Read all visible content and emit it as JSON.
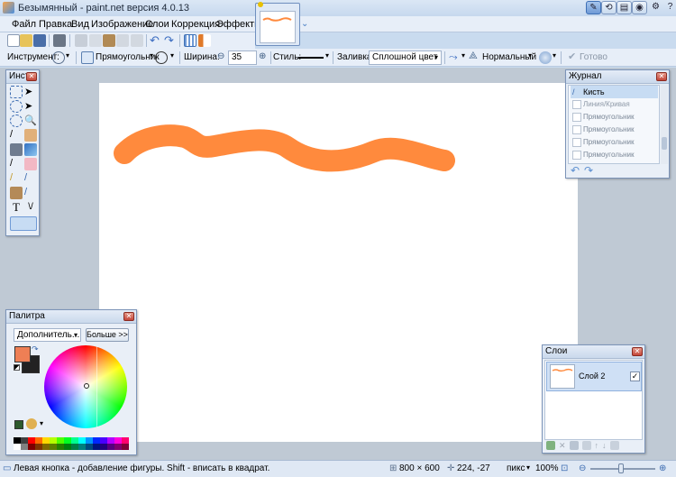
{
  "window": {
    "title": "Безымянный - paint.net версия 4.0.13"
  },
  "menu": {
    "items": [
      "Файл",
      "Правка",
      "Вид",
      "Изображение",
      "Слои",
      "Коррекция",
      "Эффекты"
    ]
  },
  "toolbar": {
    "tool_label": "Инструмент:",
    "shape_name": "Прямоугольник",
    "width_label": "Ширина:",
    "width_value": "35",
    "style_label": "Стиль:",
    "fill_label": "Заливка:",
    "fill_value": "Сплошной цвет",
    "blend_mode": "Нормальный",
    "done_label": "Готово"
  },
  "tools": {
    "title": "Инст..."
  },
  "history": {
    "title": "Журнал",
    "items": [
      "Кисть",
      "Линия/Кривая Прямоугольник",
      "Прямоугольник Прямоугольник",
      "Прямоугольник Прямоугольник",
      "Прямоугольник Прямоугольник",
      "Прямоугольник Прямоугольник",
      "Прямоугольник Прямоугольник"
    ]
  },
  "palette": {
    "title": "Палитра",
    "mode": "Дополнитель...",
    "more_button": "Больше >>",
    "primary_color": "#ee7f55",
    "secondary_color": "#222222",
    "swatches": [
      "#000000",
      "#404040",
      "#ff0000",
      "#ff6a00",
      "#ffd800",
      "#b6ff00",
      "#4cff00",
      "#00ff21",
      "#00ff90",
      "#00ffff",
      "#0094ff",
      "#0026ff",
      "#4800ff",
      "#b200ff",
      "#ff00dc",
      "#ff006e",
      "#ffffff",
      "#808080",
      "#7f0000",
      "#7f3300",
      "#7f6a00",
      "#5b7f00",
      "#267f00",
      "#007f0e",
      "#007f46",
      "#007f7f",
      "#004a7f",
      "#00137f",
      "#21007f",
      "#57007f",
      "#7f006e",
      "#7f0037"
    ]
  },
  "layers": {
    "title": "Слои",
    "items": [
      {
        "name": "Слой 2",
        "visible": true
      }
    ]
  },
  "canvas": {
    "stroke_color": "#ff8a3d"
  },
  "status": {
    "hint": "Левая кнопка - добавление фигуры. Shift - вписать в квадрат.",
    "size": "800 × 600",
    "cursor": "224, -27",
    "unit": "пикс",
    "zoom": "100%"
  }
}
